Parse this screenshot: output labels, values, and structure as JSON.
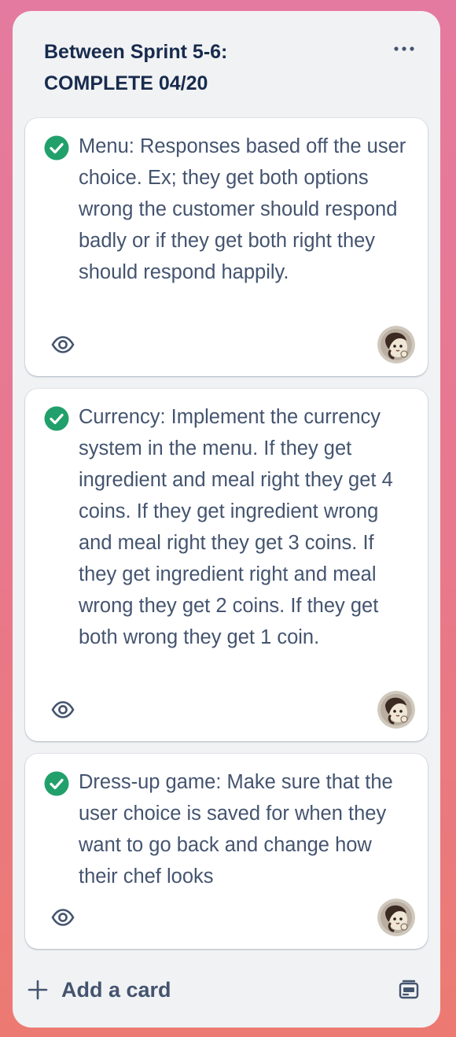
{
  "list": {
    "title": "Between Sprint 5-6:\nCOMPLETE 04/20",
    "menu_icon": "ellipsis-icon"
  },
  "cards": [
    {
      "title": "Menu: Responses based off the user choice. Ex; they get both options wrong the customer should respond badly or if they get both right they should respond happily.",
      "complete": true,
      "watching": true
    },
    {
      "title": "Currency: Implement the currency system in the menu. If they get ingredient and meal right they get 4 coins. If they get ingredient wrong and meal right they get 3 coins. If they get ingredient right and meal wrong they get 2 coins. If they get both wrong they get 1 coin.",
      "complete": true,
      "watching": true
    },
    {
      "title": "Dress-up game: Make sure that the user choice is saved for when they want to go back and change how their chef looks",
      "complete": true,
      "watching": true
    }
  ],
  "footer": {
    "add_card_label": "Add a card",
    "add_icon": "plus-icon",
    "template_icon": "card-template-icon"
  },
  "colors": {
    "complete_green": "#22a06b",
    "text": "#44546f",
    "title": "#172b4d"
  }
}
